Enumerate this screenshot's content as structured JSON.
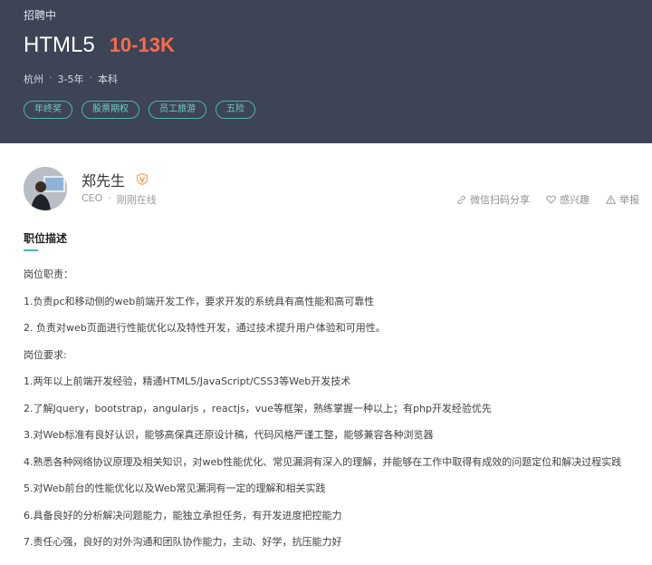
{
  "header": {
    "status": "招聘中",
    "title": "HTML5",
    "salary": "10-13K",
    "meta": [
      "杭州",
      "3-5年",
      "本科"
    ],
    "meta_separator": "·",
    "tags": [
      "年终奖",
      "股票期权",
      "员工旅游",
      "五险"
    ]
  },
  "recruiter": {
    "name": "郑先生",
    "role": "CEO",
    "separator": "·",
    "online_status": "刚刚在线"
  },
  "actions": {
    "share": "微信扫码分享",
    "interest": "感兴趣",
    "report": "举报"
  },
  "section": {
    "title": "职位描述"
  },
  "description": [
    "岗位职责：",
    "1.负责pc和移动侧的web前端开发工作，要求开发的系统具有高性能和高可靠性",
    "2. 负责对web页面进行性能优化以及特性开发，通过技术提升用户体验和可用性。",
    "岗位要求:",
    "1.两年以上前端开发经验，精通HTML5/JavaScript/CSS3等Web开发技术",
    "2.了解Jquery，bootstrap，angularjs ，reactjs，vue等框架，熟练掌握一种以上；有php开发经验优先",
    "3.对Web标准有良好认识，能够高保真还原设计稿，代码风格严谨工整，能够兼容各种浏览器",
    "4.熟悉各种网络协议原理及相关知识，对web性能优化、常见漏洞有深入的理解，并能够在工作中取得有成效的问题定位和解决过程实践",
    "5.对Web前台的性能优化以及Web常见漏洞有一定的理解和相关实践",
    "6.具备良好的分析解决问题能力，能独立承担任务，有开发进度把控能力",
    "7.责任心强，良好的对外沟通和团队协作能力，主动、好学，抗压能力好"
  ],
  "colors": {
    "header_bg": "#3c4456",
    "salary": "#fe6a4a",
    "accent": "#4bb8a8"
  },
  "icons": {
    "verified": "verified-badge-icon",
    "share": "link-icon",
    "interest": "heart-icon",
    "report": "warning-icon"
  }
}
